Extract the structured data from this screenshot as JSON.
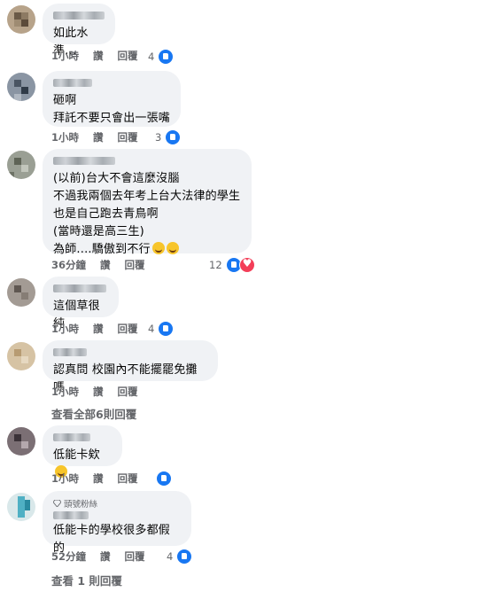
{
  "comments": [
    {
      "text": "如此水準...",
      "time": "1小時",
      "like": "讚",
      "reply": "回覆",
      "count": "4"
    },
    {
      "text": "砸啊\n拜託不要只會出一張嘴",
      "time": "1小時",
      "like": "讚",
      "reply": "回覆",
      "count": "3"
    },
    {
      "text": "(以前)台大不會這麼沒腦\n不過我兩個去年考上台大法律的學生\n也是自己跑去青鳥啊\n(當時還是高三生)\n為師....驕傲到不行",
      "time": "36分鐘",
      "like": "讚",
      "reply": "回覆",
      "count": "12"
    },
    {
      "text": "這個草很純",
      "time": "1小時",
      "like": "讚",
      "reply": "回覆",
      "count": "4"
    },
    {
      "text": "認真問 校園內不能擺罷免攤嗎",
      "time": "1小時",
      "like": "讚",
      "reply": "回覆",
      "view_replies": "查看全部6則回覆"
    },
    {
      "text": "低能卡欸",
      "time": "1小時",
      "like": "讚",
      "reply": "回覆"
    },
    {
      "badge": "頭號粉絲",
      "text": "低能卡的學校很多都假的",
      "time": "52分鐘",
      "like": "讚",
      "reply": "回覆",
      "count": "4",
      "view_replies": "查看 1 則回覆"
    }
  ],
  "colors": {
    "like_blue": "#1877f2",
    "heart_red": "#f33e58",
    "bubble": "#f0f2f5",
    "meta": "#65676b"
  }
}
